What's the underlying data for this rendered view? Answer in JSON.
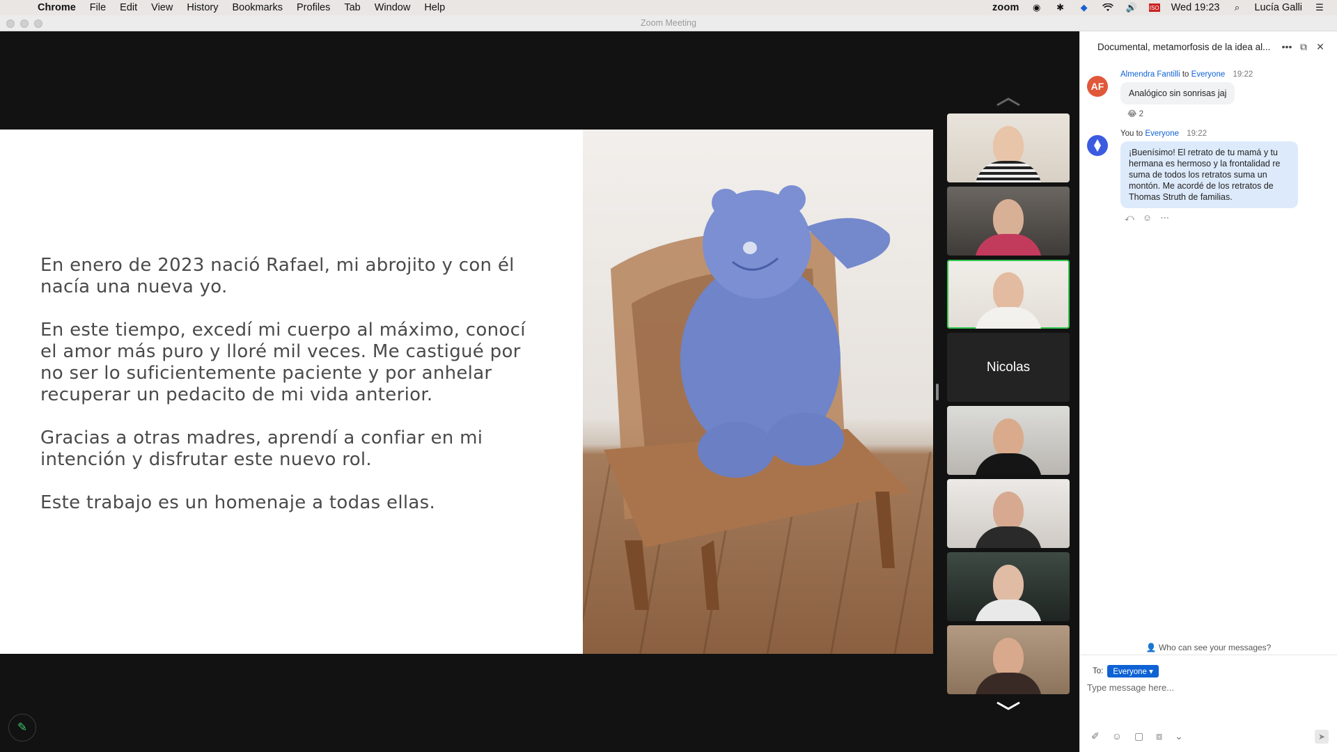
{
  "menubar": {
    "app_name": "Chrome",
    "items": [
      "File",
      "Edit",
      "View",
      "History",
      "Bookmarks",
      "Profiles",
      "Tab",
      "Window",
      "Help"
    ],
    "zoom_label": "zoom",
    "clock": "Wed 19:23",
    "user": "Lucía Galli",
    "flag_label": "ISO"
  },
  "window": {
    "title": "Zoom Meeting"
  },
  "slide": {
    "paragraphs": [
      "En enero de 2023 nació Rafael, mi abrojito y con él nacía una nueva yo.",
      "En este tiempo, excedí mi cuerpo al máximo, conocí el amor más puro y lloré mil veces. Me castigué por no ser lo suficientemente paciente y por anhelar recuperar un pedacito de mi vida anterior.",
      "Gracias a otras madres, aprendí a confiar en mi intención y disfrutar este nuevo rol.",
      "Este trabajo es un homenaje a todas ellas."
    ]
  },
  "participants": {
    "name_tile": "Nicolas"
  },
  "chat": {
    "title": "Documental, metamorfosis de la idea al...",
    "messages": [
      {
        "avatar_initials": "AF",
        "avatar_color": "#e0583a",
        "sender": "Almendra Fantilli",
        "to_word": "to",
        "recipient": "Everyone",
        "time": "19:22",
        "text": "Analógico sin sonrisas jaj",
        "reaction_emoji": "😂",
        "reaction_count": "2"
      },
      {
        "avatar_color": "#3b5be0",
        "sender": "You",
        "to_word": "to",
        "recipient": "Everyone",
        "time": "19:22",
        "text": "¡Buenísimo! El retrato de tu mamá y tu hermana es hermoso y la frontalidad re suma de todos los retratos suma un montón. Me acordé de los retratos de Thomas Struth de familias."
      }
    ],
    "privacy_note": "Who can see your messages?",
    "to_label": "To:",
    "recipient_select": "Everyone",
    "input_placeholder": "Type message here..."
  }
}
